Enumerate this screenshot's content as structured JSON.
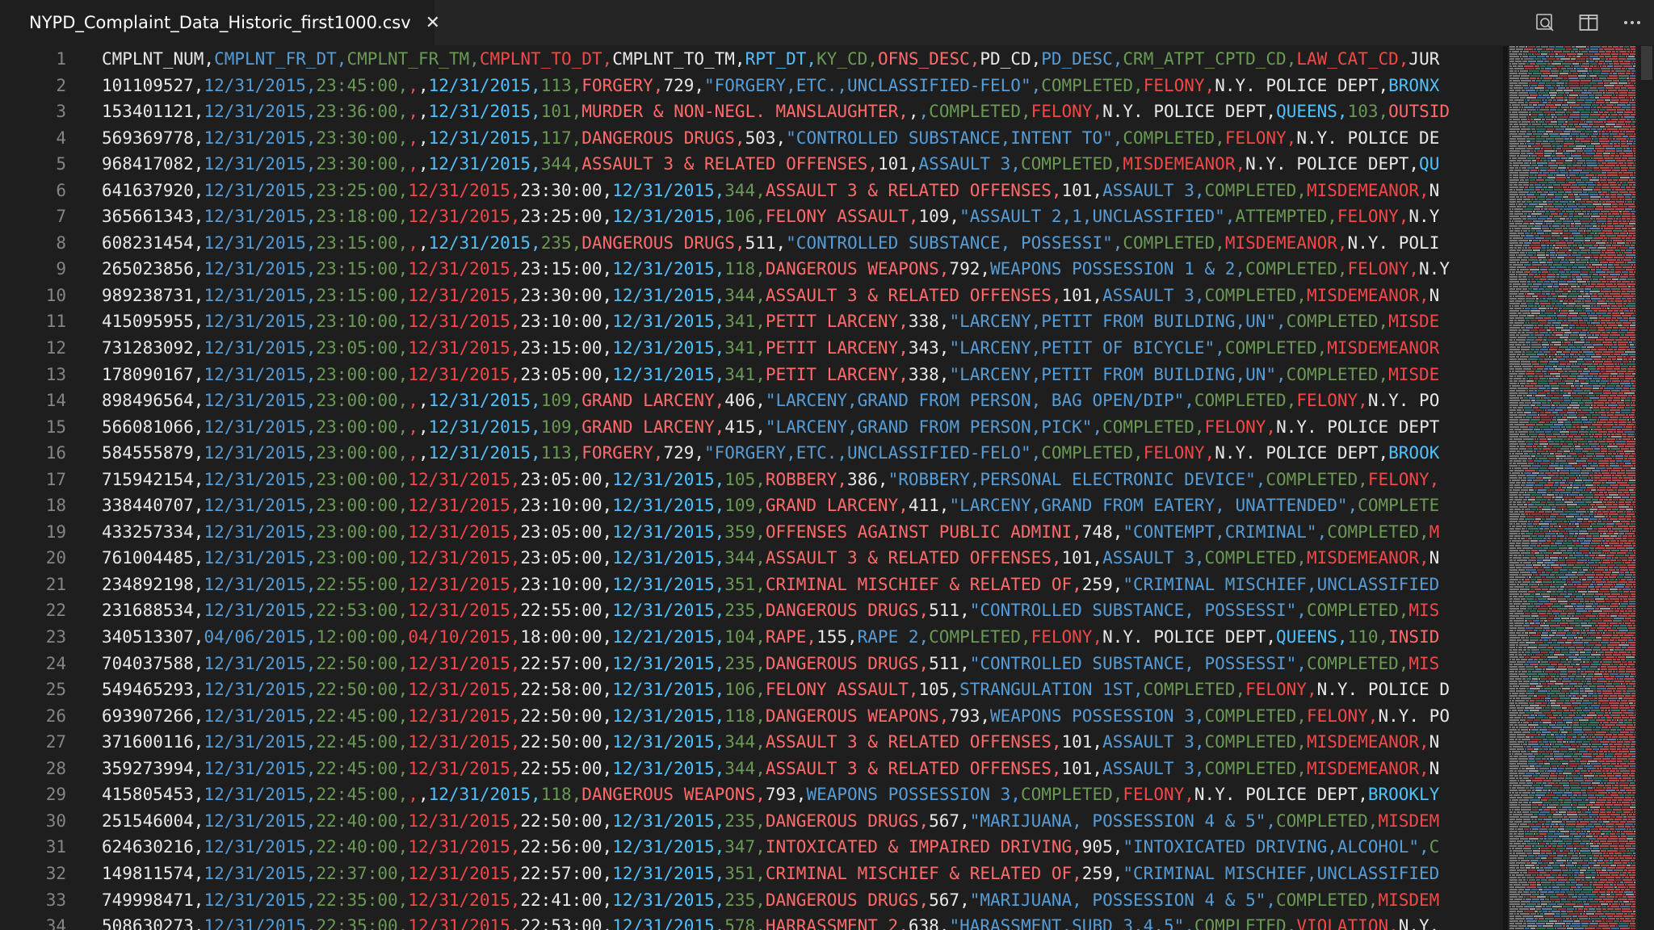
{
  "tab": {
    "title": "NYPD_Complaint_Data_Historic_first1000.csv",
    "close_label": "✕"
  },
  "actions": [
    {
      "name": "open-preview-icon"
    },
    {
      "name": "split-editor-icon"
    },
    {
      "name": "more-actions-icon"
    }
  ],
  "colors": {
    "accent_file_icon": "#4ec26b",
    "field_palette": [
      "#e8e8e8",
      "#569cd6",
      "#6a9955",
      "#f44747",
      "#e8e8e8",
      "#4fc1ff",
      "#6a9955",
      "#ff6b6b"
    ]
  },
  "editor": {
    "line_numbers": [
      "1",
      "2",
      "3",
      "4",
      "5",
      "6",
      "7",
      "8",
      "9",
      "10",
      "11",
      "12",
      "13",
      "14",
      "15",
      "16",
      "17",
      "18",
      "19",
      "20",
      "21",
      "22",
      "23",
      "24",
      "25",
      "26",
      "27",
      "28",
      "29",
      "30",
      "31",
      "32",
      "33",
      "34"
    ],
    "lines": [
      "CMPLNT_NUM,CMPLNT_FR_DT,CMPLNT_FR_TM,CMPLNT_TO_DT,CMPLNT_TO_TM,RPT_DT,KY_CD,OFNS_DESC,PD_CD,PD_DESC,CRM_ATPT_CPTD_CD,LAW_CAT_CD,JUR",
      "101109527,12/31/2015,23:45:00,,,12/31/2015,113,FORGERY,729,\"FORGERY,ETC.,UNCLASSIFIED-FELO\",COMPLETED,FELONY,N.Y. POLICE DEPT,BRONX",
      "153401121,12/31/2015,23:36:00,,,12/31/2015,101,MURDER & NON-NEGL. MANSLAUGHTER,,,COMPLETED,FELONY,N.Y. POLICE DEPT,QUEENS,103,OUTSID",
      "569369778,12/31/2015,23:30:00,,,12/31/2015,117,DANGEROUS DRUGS,503,\"CONTROLLED SUBSTANCE,INTENT TO\",COMPLETED,FELONY,N.Y. POLICE DE",
      "968417082,12/31/2015,23:30:00,,,12/31/2015,344,ASSAULT 3 & RELATED OFFENSES,101,ASSAULT 3,COMPLETED,MISDEMEANOR,N.Y. POLICE DEPT,QU",
      "641637920,12/31/2015,23:25:00,12/31/2015,23:30:00,12/31/2015,344,ASSAULT 3 & RELATED OFFENSES,101,ASSAULT 3,COMPLETED,MISDEMEANOR,N",
      "365661343,12/31/2015,23:18:00,12/31/2015,23:25:00,12/31/2015,106,FELONY ASSAULT,109,\"ASSAULT 2,1,UNCLASSIFIED\",ATTEMPTED,FELONY,N.Y",
      "608231454,12/31/2015,23:15:00,,,12/31/2015,235,DANGEROUS DRUGS,511,\"CONTROLLED SUBSTANCE, POSSESSI\",COMPLETED,MISDEMEANOR,N.Y. POLI",
      "265023856,12/31/2015,23:15:00,12/31/2015,23:15:00,12/31/2015,118,DANGEROUS WEAPONS,792,WEAPONS POSSESSION 1 & 2,COMPLETED,FELONY,N.Y",
      "989238731,12/31/2015,23:15:00,12/31/2015,23:30:00,12/31/2015,344,ASSAULT 3 & RELATED OFFENSES,101,ASSAULT 3,COMPLETED,MISDEMEANOR,N",
      "415095955,12/31/2015,23:10:00,12/31/2015,23:10:00,12/31/2015,341,PETIT LARCENY,338,\"LARCENY,PETIT FROM BUILDING,UN\",COMPLETED,MISDE",
      "731283092,12/31/2015,23:05:00,12/31/2015,23:15:00,12/31/2015,341,PETIT LARCENY,343,\"LARCENY,PETIT OF BICYCLE\",COMPLETED,MISDEMEANOR",
      "178090167,12/31/2015,23:00:00,12/31/2015,23:05:00,12/31/2015,341,PETIT LARCENY,338,\"LARCENY,PETIT FROM BUILDING,UN\",COMPLETED,MISDE",
      "898496564,12/31/2015,23:00:00,,,12/31/2015,109,GRAND LARCENY,406,\"LARCENY,GRAND FROM PERSON, BAG OPEN/DIP\",COMPLETED,FELONY,N.Y. PO",
      "566081066,12/31/2015,23:00:00,,,12/31/2015,109,GRAND LARCENY,415,\"LARCENY,GRAND FROM PERSON,PICK\",COMPLETED,FELONY,N.Y. POLICE DEPT",
      "584555879,12/31/2015,23:00:00,,,12/31/2015,113,FORGERY,729,\"FORGERY,ETC.,UNCLASSIFIED-FELO\",COMPLETED,FELONY,N.Y. POLICE DEPT,BROOK",
      "715942154,12/31/2015,23:00:00,12/31/2015,23:05:00,12/31/2015,105,ROBBERY,386,\"ROBBERY,PERSONAL ELECTRONIC DEVICE\",COMPLETED,FELONY,",
      "338440707,12/31/2015,23:00:00,12/31/2015,23:10:00,12/31/2015,109,GRAND LARCENY,411,\"LARCENY,GRAND FROM EATERY, UNATTENDED\",COMPLETE",
      "433257334,12/31/2015,23:00:00,12/31/2015,23:05:00,12/31/2015,359,OFFENSES AGAINST PUBLIC ADMINI,748,\"CONTEMPT,CRIMINAL\",COMPLETED,M",
      "761004485,12/31/2015,23:00:00,12/31/2015,23:05:00,12/31/2015,344,ASSAULT 3 & RELATED OFFENSES,101,ASSAULT 3,COMPLETED,MISDEMEANOR,N",
      "234892198,12/31/2015,22:55:00,12/31/2015,23:10:00,12/31/2015,351,CRIMINAL MISCHIEF & RELATED OF,259,\"CRIMINAL MISCHIEF,UNCLASSIFIED",
      "231688534,12/31/2015,22:53:00,12/31/2015,22:55:00,12/31/2015,235,DANGEROUS DRUGS,511,\"CONTROLLED SUBSTANCE, POSSESSI\",COMPLETED,MIS",
      "340513307,04/06/2015,12:00:00,04/10/2015,18:00:00,12/21/2015,104,RAPE,155,RAPE 2,COMPLETED,FELONY,N.Y. POLICE DEPT,QUEENS,110,INSID",
      "704037588,12/31/2015,22:50:00,12/31/2015,22:57:00,12/31/2015,235,DANGEROUS DRUGS,511,\"CONTROLLED SUBSTANCE, POSSESSI\",COMPLETED,MIS",
      "549465293,12/31/2015,22:50:00,12/31/2015,22:58:00,12/31/2015,106,FELONY ASSAULT,105,STRANGULATION 1ST,COMPLETED,FELONY,N.Y. POLICE D",
      "693907266,12/31/2015,22:45:00,12/31/2015,22:50:00,12/31/2015,118,DANGEROUS WEAPONS,793,WEAPONS POSSESSION 3,COMPLETED,FELONY,N.Y. PO",
      "371600116,12/31/2015,22:45:00,12/31/2015,22:50:00,12/31/2015,344,ASSAULT 3 & RELATED OFFENSES,101,ASSAULT 3,COMPLETED,MISDEMEANOR,N",
      "359273994,12/31/2015,22:45:00,12/31/2015,22:55:00,12/31/2015,344,ASSAULT 3 & RELATED OFFENSES,101,ASSAULT 3,COMPLETED,MISDEMEANOR,N",
      "415805453,12/31/2015,22:45:00,,,12/31/2015,118,DANGEROUS WEAPONS,793,WEAPONS POSSESSION 3,COMPLETED,FELONY,N.Y. POLICE DEPT,BROOKLY",
      "251546004,12/31/2015,22:40:00,12/31/2015,22:50:00,12/31/2015,235,DANGEROUS DRUGS,567,\"MARIJUANA, POSSESSION 4 & 5\",COMPLETED,MISDEM",
      "624630216,12/31/2015,22:40:00,12/31/2015,22:56:00,12/31/2015,347,INTOXICATED & IMPAIRED DRIVING,905,\"INTOXICATED DRIVING,ALCOHOL\",C",
      "149811574,12/31/2015,22:37:00,12/31/2015,22:57:00,12/31/2015,351,CRIMINAL MISCHIEF & RELATED OF,259,\"CRIMINAL MISCHIEF,UNCLASSIFIED",
      "749998471,12/31/2015,22:35:00,12/31/2015,22:41:00,12/31/2015,235,DANGEROUS DRUGS,567,\"MARIJUANA, POSSESSION 4 & 5\",COMPLETED,MISDEM",
      "508630273,12/31/2015,22:35:00,12/31/2015,22:53:00,12/31/2015,578,HARRASSMENT 2,638,\"HARASSMENT,SUBD 3,4,5\",COMPLETED,VIOLATION,N.Y."
    ]
  }
}
